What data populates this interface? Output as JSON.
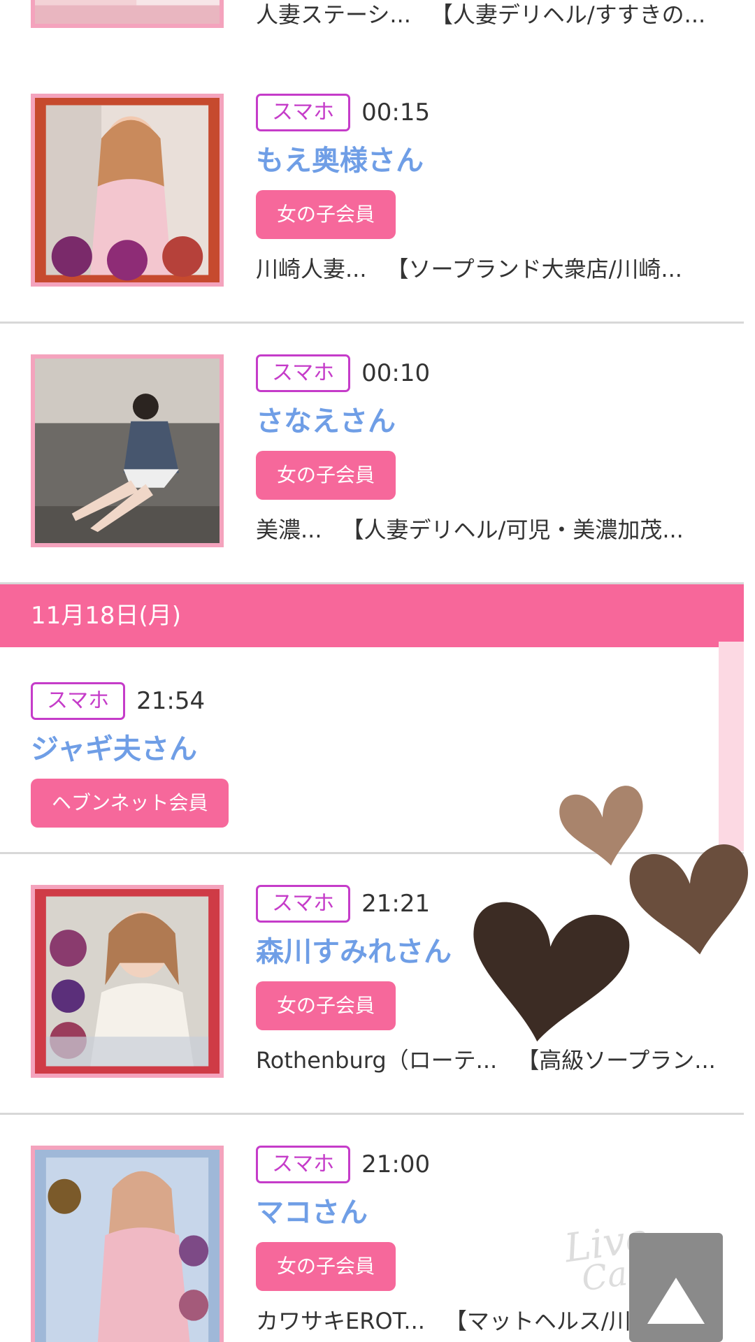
{
  "entries": [
    {
      "device": "",
      "time": "",
      "name": "",
      "member": "",
      "area": "人妻ステーシ...",
      "shop": "【人妻デリヘル/すすきの..."
    },
    {
      "device": "スマホ",
      "time": "00:15",
      "name": "もえ奥様さん",
      "member": "女の子会員",
      "area": "川崎人妻...",
      "shop": "【ソープランド大衆店/川崎..."
    },
    {
      "device": "スマホ",
      "time": "00:10",
      "name": "さなえさん",
      "member": "女の子会員",
      "area": "美濃...",
      "shop": "【人妻デリヘル/可児・美濃加茂..."
    },
    {
      "date": "11月18日(月)"
    },
    {
      "device": "スマホ",
      "time": "21:54",
      "name": "ジャギ夫さん",
      "member": "ヘブンネット会員"
    },
    {
      "device": "スマホ",
      "time": "21:21",
      "name": "森川すみれさん",
      "member": "女の子会員",
      "area": "Rothenburg（ローテ...",
      "shop": "【高級ソープラン..."
    },
    {
      "device": "スマホ",
      "time": "21:00",
      "name": "マコさん",
      "member": "女の子会員",
      "area": "カワサキEROT...",
      "shop": "【マットヘルス/川崎堀..."
    }
  ],
  "colors": {
    "accent_pink": "#f6689b",
    "device_purple": "#c53cc9",
    "name_blue": "#6f9ee6",
    "thumb_border": "#f4a3bd"
  },
  "scroll_top_icon": "triangle-up-icon",
  "watermark": {
    "line1": "Live",
    "line2": "Camera"
  }
}
